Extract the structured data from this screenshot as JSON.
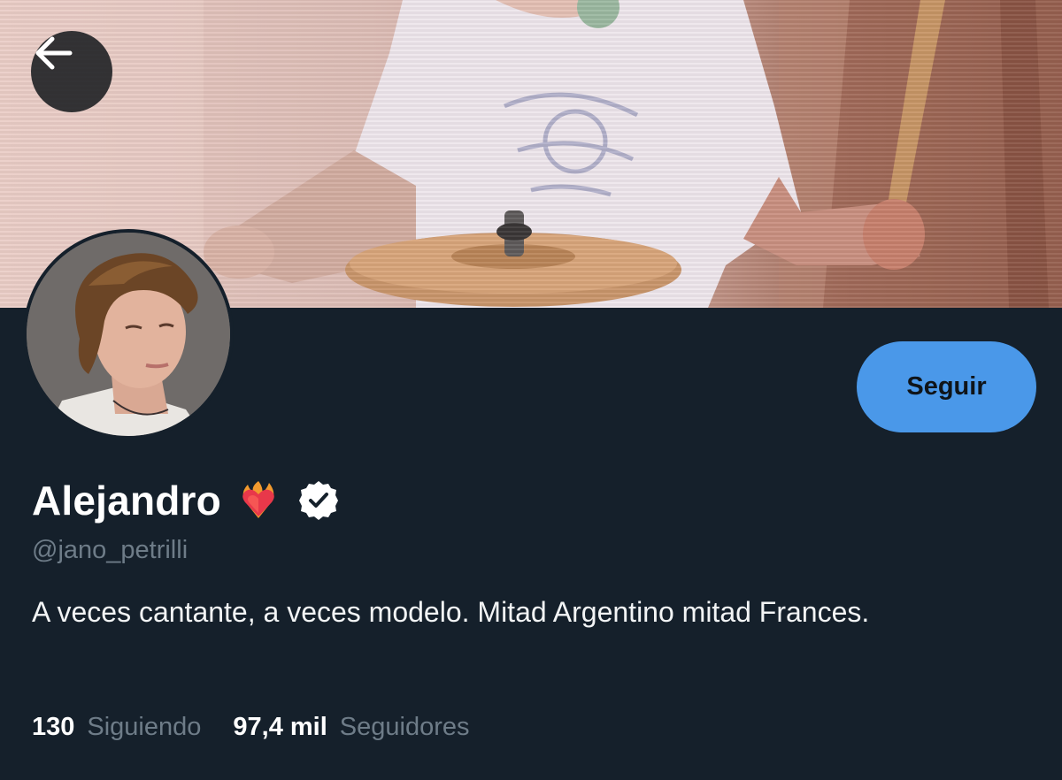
{
  "profile": {
    "display_name": "Alejandro",
    "name_emoji": "heart-on-fire-icon",
    "verified": true,
    "handle": "@jano_petrilli",
    "bio": "A veces cantante, a veces modelo. Mitad Argentino mitad Frances.",
    "following_count": "130",
    "following_label": "Siguiendo",
    "followers_count": "97,4 mil",
    "followers_label": "Seguidores"
  },
  "actions": {
    "follow_label": "Seguir",
    "back_icon": "arrow-left-icon"
  },
  "colors": {
    "background": "#15202b",
    "accent": "#4a98e9",
    "secondary_text": "#6e7c88",
    "primary_text": "#ffffff"
  }
}
